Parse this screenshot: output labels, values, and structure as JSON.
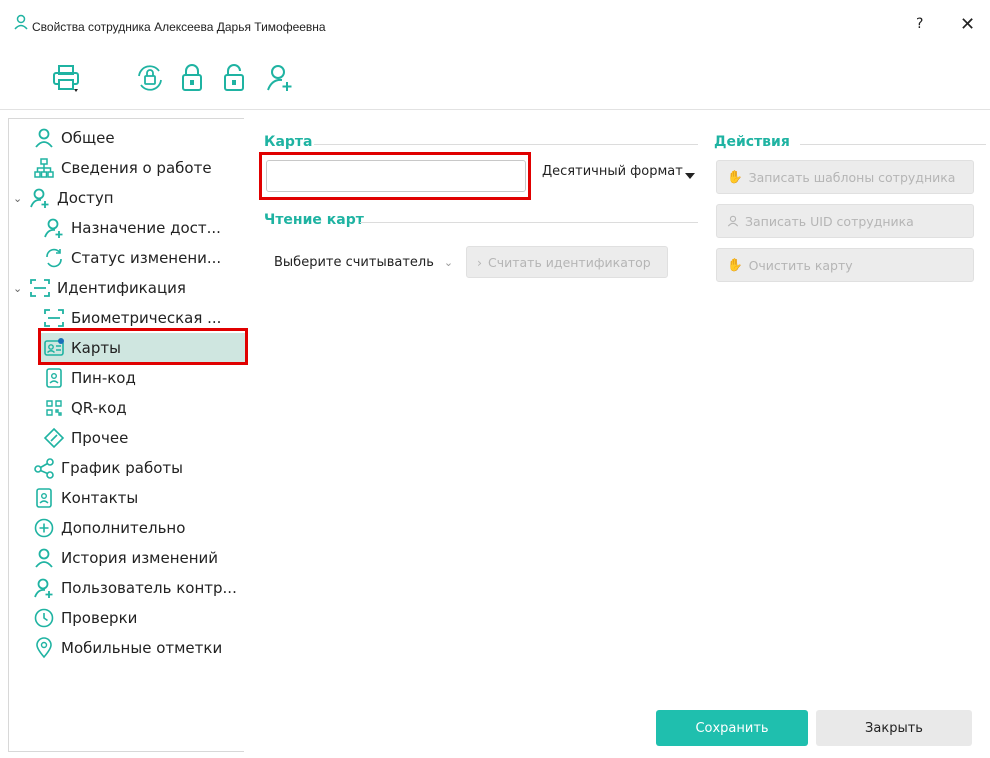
{
  "window": {
    "title": "Свойства сотрудника Алексеева Дарья Тимофеевна",
    "help": "?",
    "close": "✕"
  },
  "toolbar": {
    "icons": [
      "printer-icon",
      "sync-lock-icon",
      "lock-icon",
      "unlock-icon",
      "add-user-icon"
    ]
  },
  "sidebar": {
    "items": [
      {
        "label": "Общее",
        "icon": "user-icon"
      },
      {
        "label": "Сведения о работе",
        "icon": "org-structure-icon"
      },
      {
        "label": "Доступ",
        "icon": "access-user-icon",
        "expanded": true
      },
      {
        "label": "Назначение дост...",
        "icon": "access-assign-icon"
      },
      {
        "label": "Статус изменени...",
        "icon": "refresh-icon"
      },
      {
        "label": "Идентификация",
        "icon": "scan-icon",
        "expanded": true
      },
      {
        "label": "Биометрическая ...",
        "icon": "scan-icon"
      },
      {
        "label": "Карты",
        "icon": "id-card-icon",
        "selected": true
      },
      {
        "label": "Пин-код",
        "icon": "pin-code-icon"
      },
      {
        "label": "QR-код",
        "icon": "qr-code-icon"
      },
      {
        "label": "Прочее",
        "icon": "tag-icon"
      },
      {
        "label": "График работы",
        "icon": "share-icon"
      },
      {
        "label": "Контакты",
        "icon": "contacts-icon"
      },
      {
        "label": "Дополнительно",
        "icon": "plus-circle-icon"
      },
      {
        "label": "История изменений",
        "icon": "user-icon"
      },
      {
        "label": "Пользователь контр...",
        "icon": "add-user-icon"
      },
      {
        "label": "Проверки",
        "icon": "clock-icon"
      },
      {
        "label": "Мобильные отметки",
        "icon": "location-pin-icon"
      }
    ]
  },
  "card": {
    "section_title": "Карта",
    "input_value": "",
    "format_label": "Десятичный формат"
  },
  "reading": {
    "section_title": "Чтение карт",
    "reader_placeholder": "Выберите считыватель",
    "read_button": "Считать идентификатор"
  },
  "actions": {
    "section_title": "Действия",
    "write_templates": "Записать шаблоны сотрудника",
    "write_uid": "Записать UID сотрудника",
    "clear_card": "Очистить карту"
  },
  "footer": {
    "save": "Сохранить",
    "close": "Закрыть"
  },
  "colors": {
    "accent": "#1fb3a2",
    "selected_bg": "#cfe6e0",
    "highlight": "#e00000"
  }
}
